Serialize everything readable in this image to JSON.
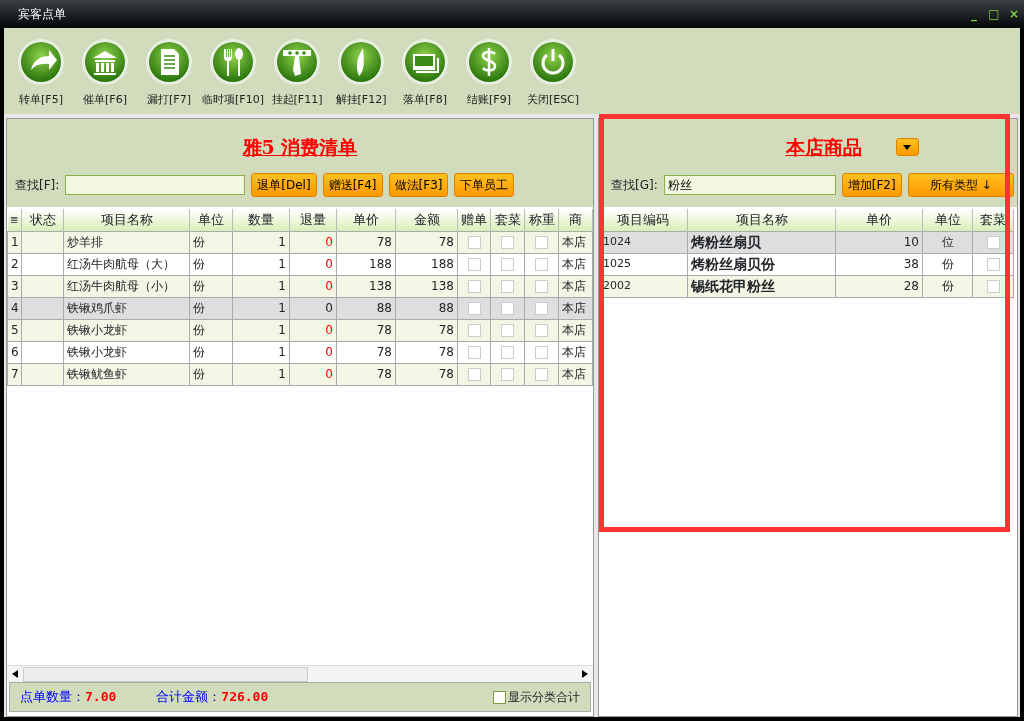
{
  "window": {
    "title": "宾客点单",
    "controls": [
      "_",
      "□",
      "×"
    ]
  },
  "toolbar": [
    {
      "label": "转单[F5]"
    },
    {
      "label": "催单[F6]"
    },
    {
      "label": "漏打[F7]"
    },
    {
      "label": "临时项[F10]"
    },
    {
      "label": "挂起[F11]"
    },
    {
      "label": "解挂[F12]"
    },
    {
      "label": "落单[F8]"
    },
    {
      "label": "结账[F9]"
    },
    {
      "label": "关闭[ESC]"
    }
  ],
  "order": {
    "title": "雅5  消费清单",
    "search_label": "查找[F]:",
    "buttons": [
      "退单[Del]",
      "赠送[F4]",
      "做法[F3]",
      "下单员工"
    ],
    "columns": [
      "≣",
      "状态",
      "项目名称",
      "单位",
      "数量",
      "退量",
      "单价",
      "金额",
      "赠单",
      "套菜",
      "称重",
      "商"
    ],
    "rows": [
      {
        "no": "1",
        "status": "",
        "name": "炒羊排",
        "unit": "份",
        "qty": "1",
        "returned": "0",
        "price": "78",
        "amount": "78",
        "gift": false,
        "set": false,
        "weigh": false,
        "source": "本店",
        "selected": false
      },
      {
        "no": "2",
        "status": "",
        "name": "红汤牛肉航母（大）",
        "unit": "份",
        "qty": "1",
        "returned": "0",
        "price": "188",
        "amount": "188",
        "gift": false,
        "set": false,
        "weigh": false,
        "source": "本店",
        "selected": false
      },
      {
        "no": "3",
        "status": "",
        "name": "红汤牛肉航母（小）",
        "unit": "份",
        "qty": "1",
        "returned": "0",
        "price": "138",
        "amount": "138",
        "gift": false,
        "set": false,
        "weigh": false,
        "source": "本店",
        "selected": false
      },
      {
        "no": "4",
        "status": "",
        "name": "铁锹鸡爪虾",
        "unit": "份",
        "qty": "1",
        "returned": "0",
        "price": "88",
        "amount": "88",
        "gift": false,
        "set": false,
        "weigh": false,
        "source": "本店",
        "selected": true
      },
      {
        "no": "5",
        "status": "",
        "name": "铁锹小龙虾",
        "unit": "份",
        "qty": "1",
        "returned": "0",
        "price": "78",
        "amount": "78",
        "gift": false,
        "set": false,
        "weigh": false,
        "source": "本店",
        "selected": false
      },
      {
        "no": "6",
        "status": "",
        "name": "铁锹小龙虾",
        "unit": "份",
        "qty": "1",
        "returned": "0",
        "price": "78",
        "amount": "78",
        "gift": false,
        "set": false,
        "weigh": false,
        "source": "本店",
        "selected": false
      },
      {
        "no": "7",
        "status": "",
        "name": "铁锹鱿鱼虾",
        "unit": "份",
        "qty": "1",
        "returned": "0",
        "price": "78",
        "amount": "78",
        "gift": false,
        "set": false,
        "weigh": false,
        "source": "本店",
        "selected": false
      }
    ],
    "footer": {
      "count_label": "点单数量：",
      "count": "7.00",
      "total_label": "合计金额：",
      "total": "726.00",
      "show_category_label": "显示分类合计",
      "show_category": false
    }
  },
  "products": {
    "title": "本店商品",
    "search_label": "查找[G]:",
    "search_value": "粉丝",
    "buttons": [
      "增加[F2]",
      "所有类型 ↓"
    ],
    "columns": [
      "项目编码",
      "项目名称",
      "单价",
      "单位",
      "套菜"
    ],
    "rows": [
      {
        "code": "1024",
        "name": "烤粉丝扇贝",
        "price": "10",
        "unit": "位",
        "set": false,
        "selected": true
      },
      {
        "code": "1025",
        "name": "烤粉丝扇贝份",
        "price": "38",
        "unit": "份",
        "set": false,
        "selected": false
      },
      {
        "code": "2002",
        "name": "锡纸花甲粉丝",
        "price": "28",
        "unit": "份",
        "set": false,
        "selected": false
      }
    ]
  }
}
